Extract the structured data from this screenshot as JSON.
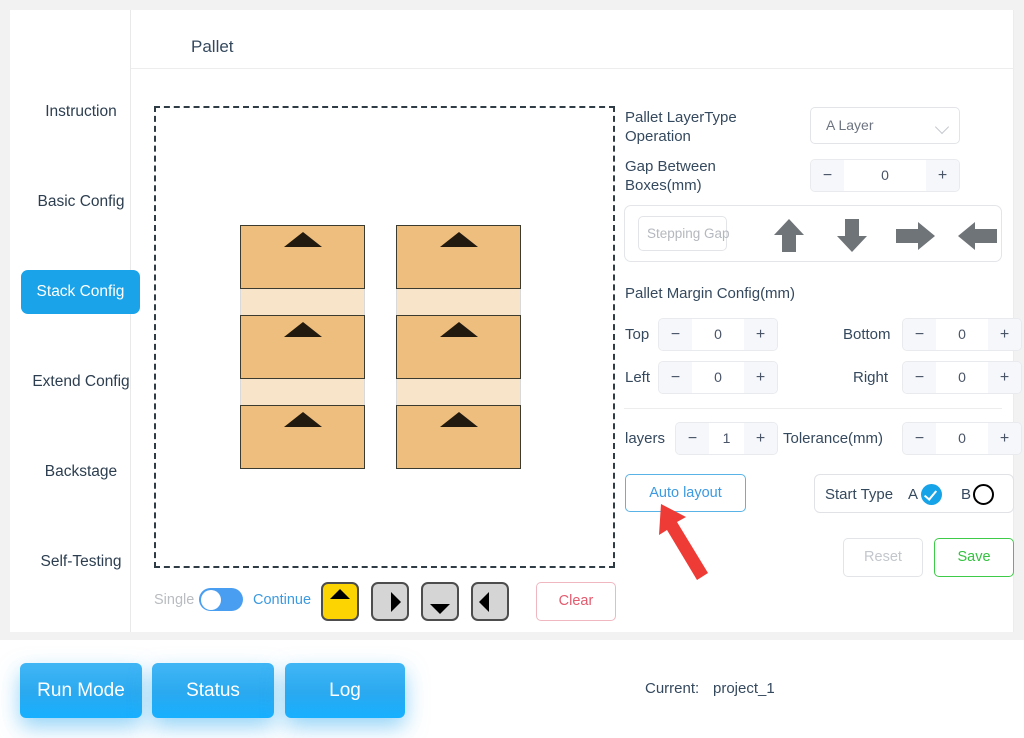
{
  "header": {
    "title": "Pallet"
  },
  "sidebar": {
    "items": [
      {
        "label": "Instruction",
        "active": false
      },
      {
        "label": "Basic Config",
        "active": false
      },
      {
        "label": "Stack Config",
        "active": true
      },
      {
        "label": "Extend Config",
        "active": false
      },
      {
        "label": "Backstage",
        "active": false
      },
      {
        "label": "Self-Testing",
        "active": false
      }
    ],
    "active_color": "#1aa3e8"
  },
  "canvas": {
    "columns": [
      {
        "boxes": 3,
        "arrow": "up-triangle"
      },
      {
        "boxes": 3,
        "arrow": "up-triangle"
      }
    ],
    "box_color": "#eebe7e",
    "gap_band_color": "#f8e4c8",
    "border_style": "dashed"
  },
  "canvas_toolbar": {
    "single_label": "Single",
    "continue_label": "Continue",
    "toggle_on": true,
    "direction_buttons": [
      {
        "name": "up-button",
        "glyph": "up-triangle",
        "highlight": true
      },
      {
        "name": "right-button",
        "glyph": "right-triangle",
        "highlight": false
      },
      {
        "name": "down-button",
        "glyph": "down-triangle",
        "highlight": false
      },
      {
        "name": "left-button",
        "glyph": "left-triangle",
        "highlight": false
      }
    ],
    "clear_label": "Clear",
    "highlight_color": "#fbd401"
  },
  "panel": {
    "layer_type_label_line1": "Pallet LayerType",
    "layer_type_label_line2": "Operation",
    "layer_type_value": "A Layer",
    "gap_label_line1": "Gap Between",
    "gap_label_line2": "Boxes(mm)",
    "gap_value": "0",
    "stepping_gap_placeholder": "Stepping Gap",
    "stepping_gap_value": "",
    "margin_title": "Pallet Margin Config(mm)",
    "margins": [
      {
        "label": "Top",
        "value": "0"
      },
      {
        "label": "Bottom",
        "value": "0"
      },
      {
        "label": "Left",
        "value": "0"
      },
      {
        "label": "Right",
        "value": "0"
      }
    ],
    "layers_label": "layers",
    "layers_value": "1",
    "tolerance_label": "Tolerance(mm)",
    "tolerance_value": "0",
    "minus_symbol": "−",
    "plus_symbol": "+",
    "auto_layout_label": "Auto layout",
    "start_type_label": "Start Type",
    "start_type_a": "A",
    "start_type_b": "B",
    "start_type_selected": "A",
    "reset_label": "Reset",
    "save_label": "Save"
  },
  "footer": {
    "buttons": [
      {
        "label": "Run Mode"
      },
      {
        "label": "Status"
      },
      {
        "label": "Log"
      }
    ],
    "current_label": "Current:",
    "current_value": "project_1",
    "button_color": "#2aa9f0"
  },
  "annotation": {
    "type": "red-arrow",
    "color": "#ee3b36",
    "points_to": "auto-layout-button"
  }
}
